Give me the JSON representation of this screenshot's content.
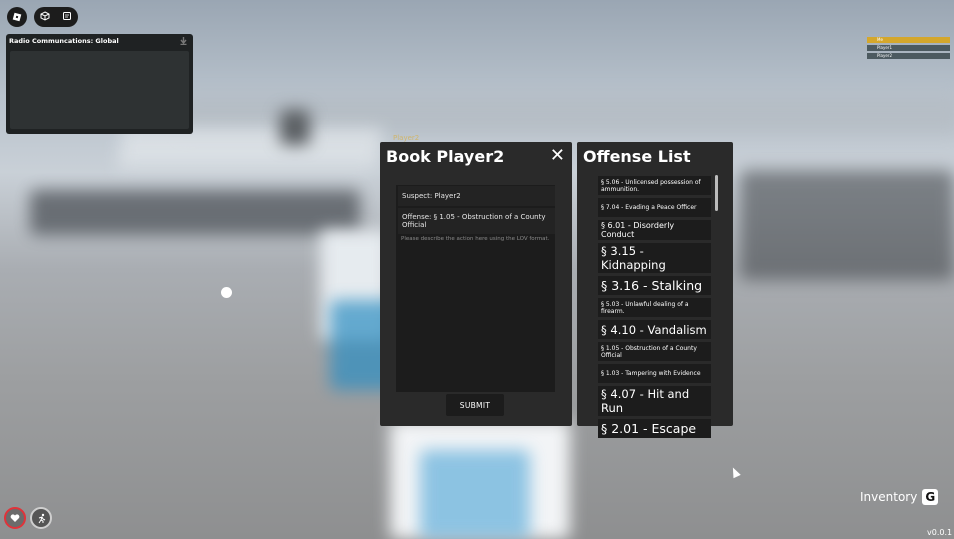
{
  "radio": {
    "title": "Radio Communcations: Global"
  },
  "player_list": [
    "Me",
    "Player1",
    "Player2"
  ],
  "nametag": "Player2",
  "book": {
    "title": "Book Player2",
    "suspect": "Suspect: Player2",
    "offense": "Offense: § 1.05 - Obstruction of a County Official",
    "placeholder": "Please describe the action here using the LOV format.",
    "submit": "SUBMIT"
  },
  "offense_list": {
    "title": "Offense List",
    "items": [
      "§ 5.06 - Unlicensed possession of ammunition.",
      "§ 7.04 - Evading a Peace Officer",
      "§ 6.01 - Disorderly Conduct",
      "§ 3.15 - Kidnapping",
      "§ 3.16 - Stalking",
      "§ 5.03 - Unlawful dealing of a firearm.",
      "§ 4.10 - Vandalism",
      "§ 1.05 - Obstruction of a County Official",
      "§ 1.03 - Tampering with Evidence",
      "§ 4.07 - Hit and Run",
      "§ 2.01 - Escape"
    ]
  },
  "inventory": {
    "label": "Inventory",
    "key": "G"
  },
  "version": "v0.0.1"
}
